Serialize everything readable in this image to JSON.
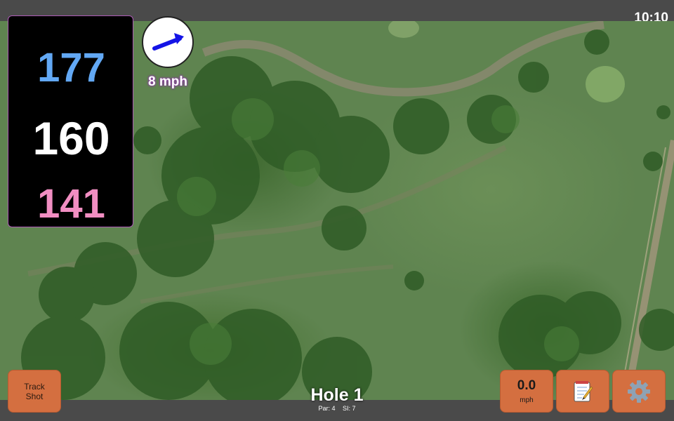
{
  "status_bar": {
    "time": "10:10"
  },
  "distances": {
    "back": "177",
    "middle": "160",
    "front": "141",
    "colors": {
      "back": "#62a8f4",
      "middle": "#ffffff",
      "front": "#f18ec2"
    }
  },
  "wind": {
    "speed_label": "8 mph",
    "icon": "wind-arrow-icon"
  },
  "track_shot": {
    "line1": "Track",
    "line2": "Shot"
  },
  "speed": {
    "value": "0.0",
    "unit": "mph"
  },
  "notes": {
    "icon": "notepad-icon"
  },
  "settings": {
    "icon": "gear-icon"
  },
  "hole": {
    "title": "Hole 1",
    "par": "Par: 4",
    "si": "SI: 7"
  },
  "colors": {
    "button": "#d46f40",
    "panel_border": "#ad5ab7",
    "bar": "#4a4a4a"
  }
}
